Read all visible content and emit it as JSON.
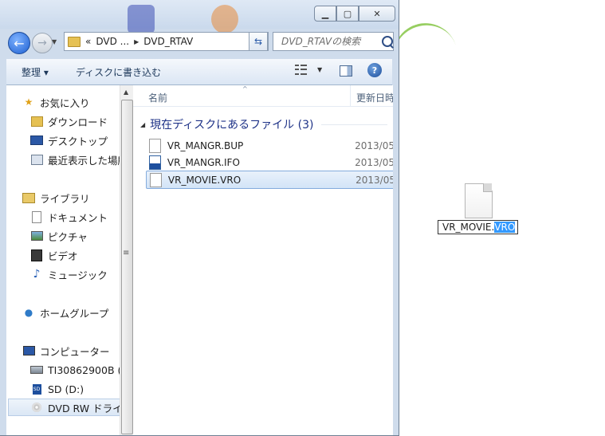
{
  "window": {
    "address": {
      "crumbs": [
        "«",
        "DVD ...",
        "DVD_RTAV"
      ],
      "search_placeholder": "DVD_RTAVの検索"
    },
    "toolbar": {
      "organize_label": "整理 ▾",
      "burn_label": "ディスクに書き込む",
      "help_label": "?"
    },
    "nav_pane": {
      "items": [
        {
          "label": "お気に入り",
          "icon": "star-icon"
        },
        {
          "label": "ダウンロード",
          "icon": "downloads-folder-icon"
        },
        {
          "label": "デスクトップ",
          "icon": "desktop-icon"
        },
        {
          "label": "最近表示した場所",
          "icon": "recent-places-icon"
        },
        {
          "label": "ライブラリ",
          "icon": "library-icon"
        },
        {
          "label": "ドキュメント",
          "icon": "documents-icon"
        },
        {
          "label": "ピクチャ",
          "icon": "pictures-icon"
        },
        {
          "label": "ビデオ",
          "icon": "videos-icon"
        },
        {
          "label": "ミュージック",
          "icon": "music-icon"
        },
        {
          "label": "ホームグループ",
          "icon": "homegroup-icon"
        },
        {
          "label": "コンピューター",
          "icon": "computer-icon"
        },
        {
          "label": "TI30862900B (C",
          "icon": "local-disk-icon"
        },
        {
          "label": "SD (D:)",
          "icon": "sd-card-icon"
        },
        {
          "label": "DVD RW ドライ",
          "icon": "dvd-drive-icon"
        }
      ]
    },
    "file_list": {
      "columns": {
        "name": "名前",
        "date": "更新日時"
      },
      "group_label": "現在ディスクにあるファイル (3)",
      "files": [
        {
          "name": "VR_MANGR.BUP",
          "date": "2013/05",
          "icon": "file-icon"
        },
        {
          "name": "VR_MANGR.IFO",
          "date": "2013/05",
          "icon": "ifo-file-icon"
        },
        {
          "name": "VR_MOVIE.VRO",
          "date": "2013/05",
          "icon": "file-icon"
        }
      ]
    }
  },
  "desktop": {
    "rename": {
      "prefix": "VR_MOVIE.",
      "selected": "VRO"
    }
  }
}
